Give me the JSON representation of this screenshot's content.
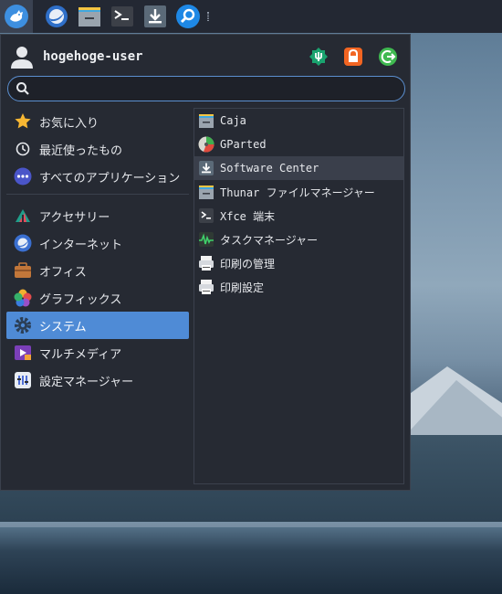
{
  "panel": {
    "launchers": [
      {
        "icon": "whisker-menu-icon"
      },
      {
        "icon": "web-browser-icon"
      },
      {
        "icon": "file-manager-icon"
      },
      {
        "icon": "terminal-icon"
      },
      {
        "icon": "software-center-icon"
      },
      {
        "icon": "app-finder-icon"
      }
    ]
  },
  "menu": {
    "user_name": "hogehoge-user",
    "actions": [
      {
        "icon": "settings-manager-icon",
        "color": "#1aa36f"
      },
      {
        "icon": "lock-screen-icon",
        "color": "#f26522"
      },
      {
        "icon": "logout-icon",
        "color": "#3fb950"
      }
    ],
    "search": {
      "placeholder": "",
      "value": ""
    },
    "categories": [
      {
        "label": "お気に入り",
        "icon": "star-icon"
      },
      {
        "label": "最近使ったもの",
        "icon": "clock-icon"
      },
      {
        "label": "すべてのアプリケーション",
        "icon": "all-apps-icon"
      },
      {
        "label": "アクセサリー",
        "icon": "accessories-icon"
      },
      {
        "label": "インターネット",
        "icon": "internet-icon"
      },
      {
        "label": "オフィス",
        "icon": "office-icon"
      },
      {
        "label": "グラフィックス",
        "icon": "graphics-icon"
      },
      {
        "label": "システム",
        "icon": "system-icon",
        "selected": true
      },
      {
        "label": "マルチメディア",
        "icon": "multimedia-icon"
      },
      {
        "label": "設定マネージャー",
        "icon": "settings-icon"
      }
    ],
    "apps": [
      {
        "label": "Caja",
        "icon": "caja-icon"
      },
      {
        "label": "GParted",
        "icon": "gparted-icon"
      },
      {
        "label": "Software Center",
        "icon": "software-center-icon",
        "hover": true
      },
      {
        "label": "Thunar ファイルマネージャー",
        "icon": "thunar-icon"
      },
      {
        "label": "Xfce 端末",
        "icon": "terminal-icon"
      },
      {
        "label": "タスクマネージャー",
        "icon": "task-manager-icon"
      },
      {
        "label": "印刷の管理",
        "icon": "print-manager-icon"
      },
      {
        "label": "印刷設定",
        "icon": "printer-settings-icon"
      }
    ]
  },
  "colors": {
    "accent": "#4f8bd6",
    "panel": "#232833",
    "menu_bg": "#262a33"
  }
}
